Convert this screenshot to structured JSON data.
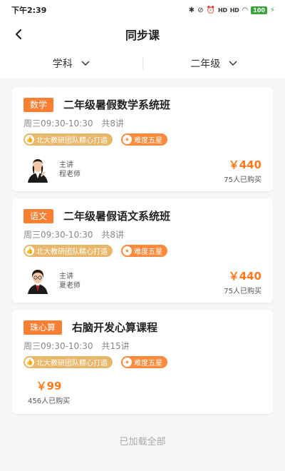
{
  "status": {
    "time": "下午2:39",
    "signal1": "HD",
    "signal2": "HD",
    "battery": "100"
  },
  "nav": {
    "title": "同步课"
  },
  "filters": [
    {
      "label": "学科"
    },
    {
      "label": "二年级"
    }
  ],
  "courses": [
    {
      "subject": "数学",
      "title": "二年级暑假数学系统班",
      "schedule_time": "周三09:30-10:30",
      "lessons": "共8讲",
      "badge_team": "北大教研团队精心打造",
      "badge_level": "难度五星",
      "teacher_role": "主讲",
      "teacher_name": "程老师",
      "price": "￥440",
      "buyers": "75人已购买"
    },
    {
      "subject": "语文",
      "title": "二年级暑假语文系统班",
      "schedule_time": "周三09:30-10:30",
      "lessons": "共8讲",
      "badge_team": "北大教研团队精心打造",
      "badge_level": "难度五星",
      "teacher_role": "主讲",
      "teacher_name": "夏老师",
      "price": "￥440",
      "buyers": "75人已购买"
    },
    {
      "subject": "珠心算",
      "title": "右脑开发心算课程",
      "schedule_time": "周三09:30-10:30",
      "lessons": "共15讲",
      "badge_team": "北大教研团队精心打造",
      "badge_level": "难度五星",
      "price": "￥99",
      "buyers": "456人已购买"
    }
  ],
  "footer": {
    "text": "已加载全部"
  },
  "colors": {
    "accent": "#ff7f32",
    "badge_team": "#e8b76a",
    "badge_level": "#ff8a3c"
  }
}
